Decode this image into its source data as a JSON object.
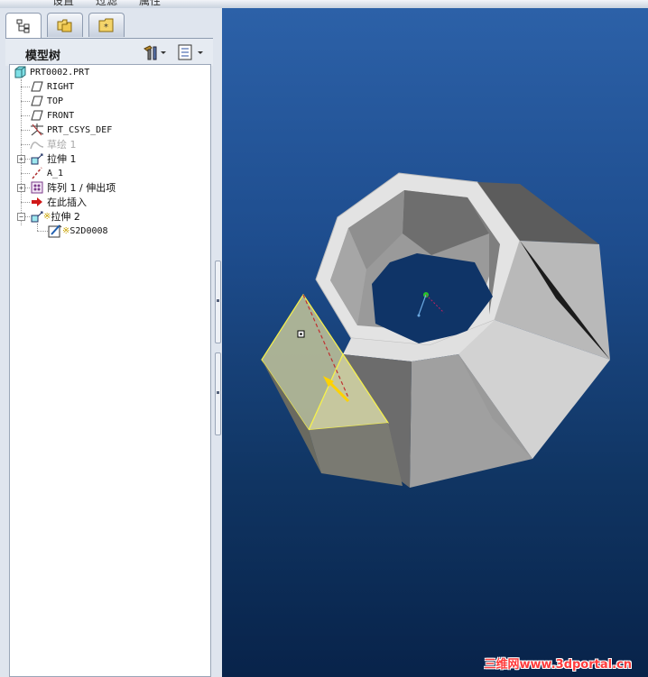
{
  "menu": {
    "items": [
      "设置",
      "过滤",
      "属性"
    ]
  },
  "panel": {
    "title": "模型树"
  },
  "tabs": [
    {
      "name": "model-tree-tab",
      "icon": "model-tree-icon",
      "active": true
    },
    {
      "name": "folder-browser-tab",
      "icon": "folder-browser-icon",
      "active": false
    },
    {
      "name": "favorites-tab",
      "icon": "favorites-icon",
      "active": false
    }
  ],
  "tree": {
    "root": "PRT0002.PRT",
    "items": [
      {
        "label": "RIGHT",
        "icon": "datum-plane-icon"
      },
      {
        "label": "TOP",
        "icon": "datum-plane-icon"
      },
      {
        "label": "FRONT",
        "icon": "datum-plane-icon"
      },
      {
        "label": "PRT_CSYS_DEF",
        "icon": "coordinate-system-icon"
      },
      {
        "label": "草绘 1",
        "icon": "sketch-icon",
        "dimmed": true
      },
      {
        "label": "拉伸 1",
        "icon": "extrude-icon",
        "expandable": true
      },
      {
        "label": "A_1",
        "icon": "datum-axis-icon"
      },
      {
        "label": "阵列 1 / 伸出项",
        "icon": "pattern-icon",
        "expandable": true
      },
      {
        "label": "在此插入",
        "icon": "insert-here-arrow-icon"
      },
      {
        "label": "拉伸 2",
        "icon": "extrude-icon",
        "expandable": true,
        "expanded": true,
        "marker": "※"
      },
      {
        "label": "S2D0008",
        "icon": "section-sketch-icon",
        "child": true,
        "marker": "※"
      }
    ]
  },
  "watermark": "三维网www.3dportal.cn",
  "colors": {
    "viewport_top": "#2c61a8",
    "viewport_bottom": "#08234a",
    "model_fill": "#a8a8a8",
    "highlight": "#f7f24a"
  }
}
